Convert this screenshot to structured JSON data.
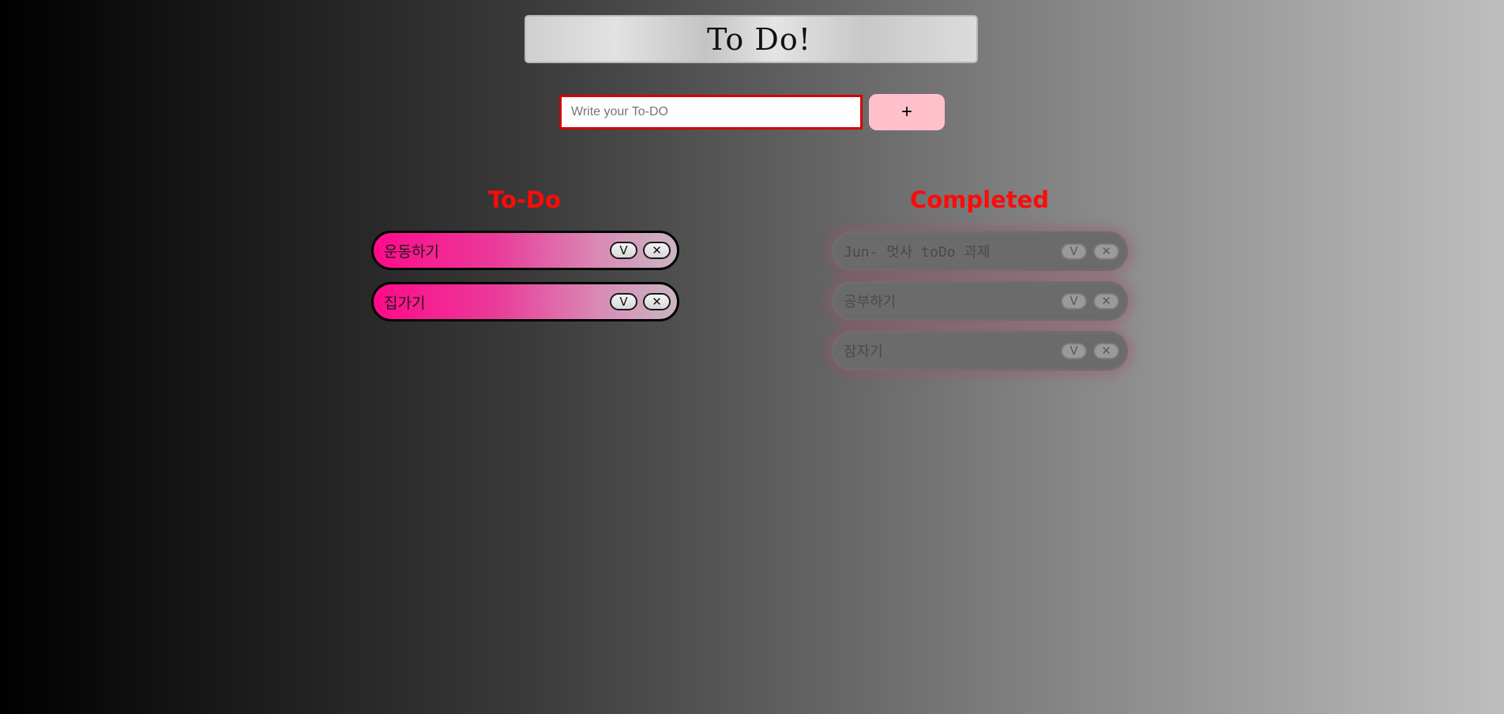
{
  "header": {
    "title": "To Do!"
  },
  "form": {
    "placeholder": "Write your To-DO",
    "value": "",
    "add_label": "+"
  },
  "todo": {
    "heading": "To-Do",
    "items": [
      {
        "label": "운동하기",
        "check_label": "V",
        "delete_label": "✕"
      },
      {
        "label": "집가기",
        "check_label": "V",
        "delete_label": "✕"
      }
    ]
  },
  "completed": {
    "heading": "Completed",
    "items": [
      {
        "label": "Jun- 멋사 toDo 과제",
        "check_label": "V",
        "delete_label": "✕"
      },
      {
        "label": "공부하기",
        "check_label": "V",
        "delete_label": "✕"
      },
      {
        "label": "잠자기",
        "check_label": "V",
        "delete_label": "✕"
      }
    ]
  },
  "colors": {
    "heading": "#ff0a0a",
    "input_border": "#d40000",
    "add_button": "#ffc0cb",
    "todo_item_start": "#ff0a8a",
    "done_item": "#6b6b6b"
  }
}
